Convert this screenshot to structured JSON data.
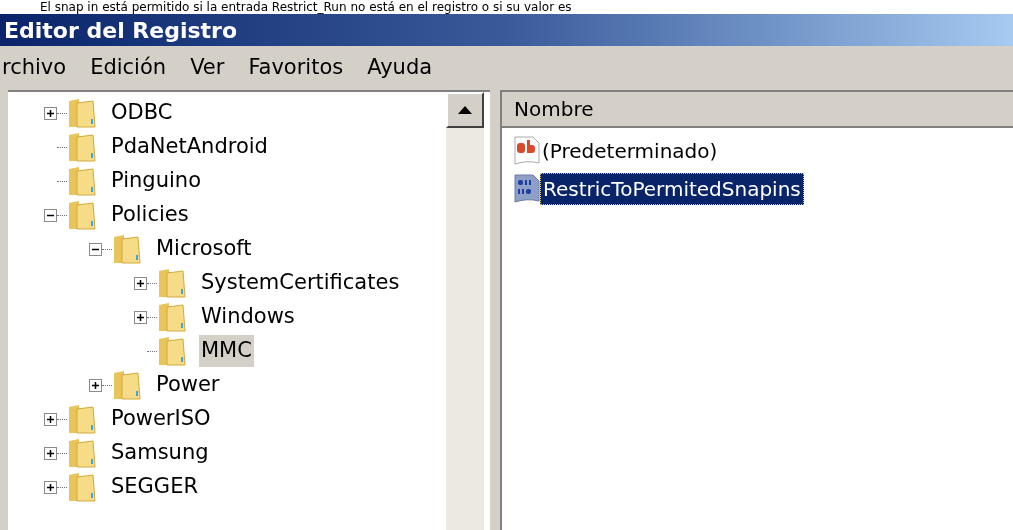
{
  "caption": "El snap in está permitido si la entrada Restrict_Run no está en el registro o si su valor es",
  "window": {
    "title": "Editor del Registro"
  },
  "menu": [
    "rchivo",
    "Edición",
    "Ver",
    "Favoritos",
    "Ayuda"
  ],
  "tree": [
    {
      "label": "ODBC",
      "expanded": false,
      "selected": false
    },
    {
      "label": "PdaNetAndroid",
      "selected": false
    },
    {
      "label": "Pinguino",
      "selected": false
    },
    {
      "label": "Policies",
      "expanded": true,
      "selected": false,
      "children": [
        {
          "label": "Microsoft",
          "expanded": true,
          "selected": false,
          "children": [
            {
              "label": "SystemCertificates",
              "expanded": false,
              "selected": false
            },
            {
              "label": "Windows",
              "expanded": false,
              "selected": false
            },
            {
              "label": "MMC",
              "selected": true
            }
          ]
        },
        {
          "label": "Power",
          "expanded": false,
          "selected": false
        }
      ]
    },
    {
      "label": "PowerISO",
      "expanded": false,
      "selected": false
    },
    {
      "label": "Samsung",
      "expanded": false,
      "selected": false
    },
    {
      "label": "SEGGER",
      "expanded": false,
      "selected": false
    }
  ],
  "values": {
    "columns": [
      "Nombre"
    ],
    "rows": [
      {
        "name": "(Predeterminado)",
        "kind": "string",
        "selected": false
      },
      {
        "name": "RestricToPermitedSnapins",
        "kind": "dword",
        "selected": true
      }
    ]
  }
}
